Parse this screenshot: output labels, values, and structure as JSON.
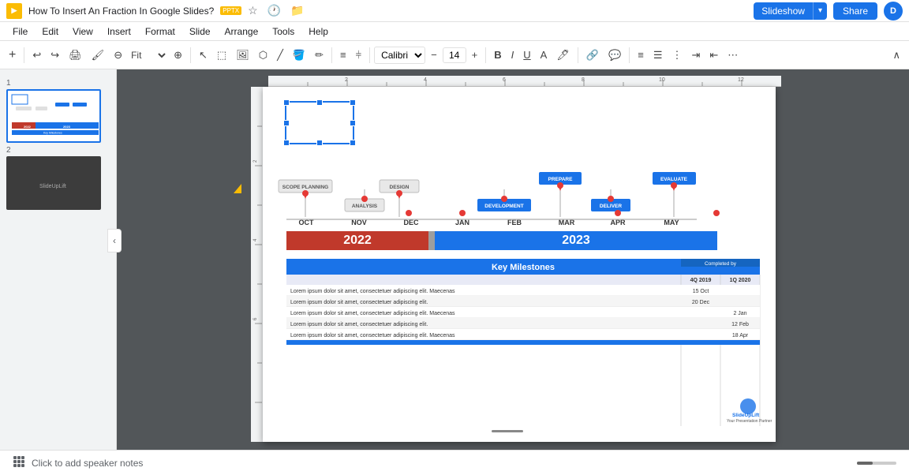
{
  "topbar": {
    "title": "How To Insert An Fraction In Google Slides?",
    "badge": "PPTX",
    "slideshow_label": "Slideshow",
    "share_label": "Share",
    "avatar_letter": "D"
  },
  "menubar": {
    "items": [
      "File",
      "Edit",
      "View",
      "Insert",
      "Format",
      "Slide",
      "Arrange",
      "Tools",
      "Help"
    ]
  },
  "toolbar": {
    "zoom_label": "Fit",
    "font": "Calibri",
    "font_size": "14",
    "bold": "B",
    "italic": "I",
    "underline": "U"
  },
  "slides": [
    {
      "num": "1",
      "active": true
    },
    {
      "num": "2",
      "active": false
    }
  ],
  "canvas": {
    "timeline_labels": {
      "months": [
        "OCT",
        "NOV",
        "DEC",
        "JAN",
        "FEB",
        "MAR",
        "APR",
        "MAY"
      ],
      "year_2022": "2022",
      "year_2023": "2023"
    },
    "milestones": [
      {
        "label": "SCOPE PLANNING",
        "type": "gray"
      },
      {
        "label": "DESIGN",
        "type": "gray"
      },
      {
        "label": "PREPARE",
        "type": "blue"
      },
      {
        "label": "EVALUATE",
        "type": "blue"
      },
      {
        "label": "ANALYSIS",
        "type": "gray"
      },
      {
        "label": "DEVELOPMENT",
        "type": "blue"
      },
      {
        "label": "DELIVER",
        "type": "blue"
      }
    ],
    "table": {
      "title": "Key Milestones",
      "completed_by": "Completed by",
      "col1": "4Q 2019",
      "col2": "1Q 2020",
      "rows": [
        {
          "text": "Lorem ipsum dolor sit amet, consectetuer adipiscing elit. Maecenas",
          "q1": "15 Oct",
          "q2": ""
        },
        {
          "text": "Lorem ipsum dolor sit amet, consectetuer adipiscing elit.",
          "q1": "20 Dec",
          "q2": ""
        },
        {
          "text": "Lorem ipsum dolor sit amet, consectetuer adipiscing elit. Maecenas",
          "q1": "",
          "q2": "2 Jan"
        },
        {
          "text": "Lorem ipsum dolor sit amet, consectetuer adipiscing elit.",
          "q1": "",
          "q2": "12 Feb"
        },
        {
          "text": "Lorem ipsum dolor sit amet, consectetuer adipiscing elit. Maecenas",
          "q1": "",
          "q2": "18 Apr"
        }
      ]
    }
  },
  "bottom": {
    "speaker_notes": "Click to add speaker notes"
  },
  "icons": {
    "undo": "↩",
    "redo": "↪",
    "print": "🖨",
    "zoom_in": "+",
    "zoom_out": "−",
    "chevron_down": "▾",
    "chevron_right": "▸",
    "star": "☆",
    "history": "🕐",
    "grid": "⊞",
    "arrow_left": "‹",
    "collapse_left": "‹"
  }
}
